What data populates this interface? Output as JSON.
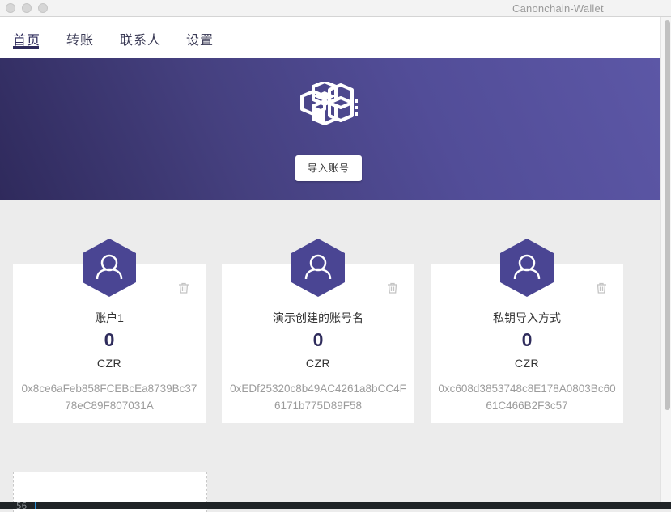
{
  "window": {
    "title": "Canonchain-Wallet"
  },
  "nav": {
    "items": [
      {
        "label": "首页",
        "active": true
      },
      {
        "label": "转账",
        "active": false
      },
      {
        "label": "联系人",
        "active": false
      },
      {
        "label": "设置",
        "active": false
      }
    ]
  },
  "banner": {
    "logo_icon": "cube-cluster-icon",
    "import_button": "导入账号"
  },
  "accounts": [
    {
      "name": "账户1",
      "balance": "0",
      "unit": "CZR",
      "address": "0x8ce6aFeb858FCEBcEa8739Bc3778eC89F807031A"
    },
    {
      "name": "演示创建的账号名",
      "balance": "0",
      "unit": "CZR",
      "address": "0xEDf25320c8b49AC4261a8bCC4F6171b775D89F58"
    },
    {
      "name": "私钥导入方式",
      "balance": "0",
      "unit": "CZR",
      "address": "0xc608d3853748c8E178A0803Bc6061C466B2F3c57"
    }
  ],
  "bottom_bar": {
    "text": "56"
  },
  "colors": {
    "brand": "#2f2c5c",
    "hex_badge": "#4a4593",
    "banner_start": "#2f2a5c",
    "banner_end": "#5c57a6"
  }
}
